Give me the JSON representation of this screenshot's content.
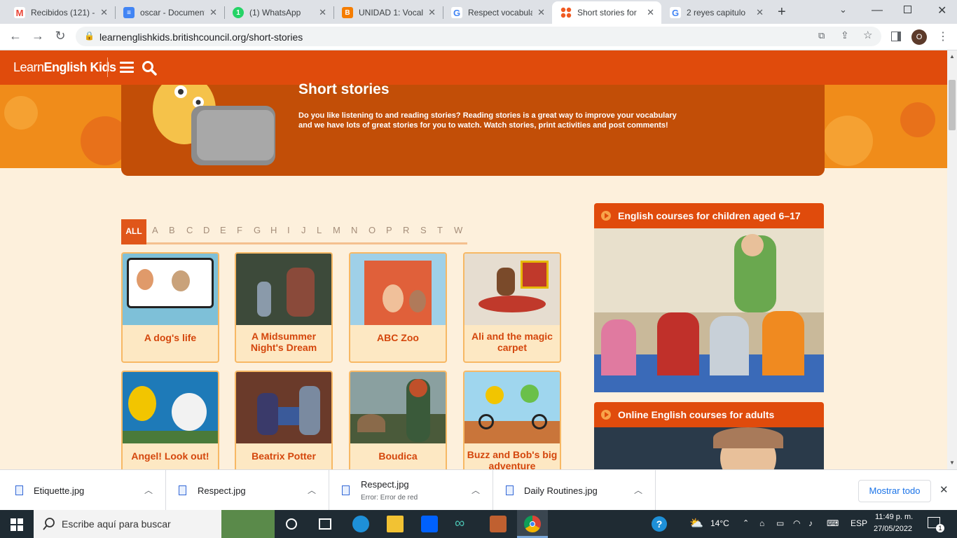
{
  "browser": {
    "tabs": [
      {
        "title": "Recibidos (121) -",
        "icon": "gmail-icon",
        "color": "#ea4335"
      },
      {
        "title": "oscar - Document",
        "icon": "docs-icon",
        "color": "#4285f4"
      },
      {
        "title": "(1) WhatsApp",
        "icon": "whatsapp-icon",
        "color": "#25d366"
      },
      {
        "title": "UNIDAD 1: Vocal",
        "icon": "blogger-icon",
        "color": "#f57d00"
      },
      {
        "title": "Respect vocabula",
        "icon": "google-icon",
        "color": "#4285f4"
      },
      {
        "title": "Short stories for",
        "icon": "britishcouncil-icon",
        "color": "#f05a22",
        "active": true
      },
      {
        "title": "2 reyes capitulo",
        "icon": "google-icon",
        "color": "#4285f4"
      }
    ],
    "url": "learnenglishkids.britishcouncil.org/short-stories",
    "profile_initial": "O"
  },
  "site": {
    "logo_light": "Learn",
    "logo_bold": "English Kids",
    "accent": "#e04b0c"
  },
  "banner": {
    "title": "Short stories",
    "text": "Do you like listening to and reading stories? Reading stories is a great way to improve your vocabulary and we have lots of great stories for you to watch. Watch stories, print activities and post comments!"
  },
  "alphabet": {
    "all": "ALL",
    "letters": [
      "A",
      "B",
      "C",
      "D",
      "E",
      "F",
      "G",
      "H",
      "I",
      "J",
      "L",
      "M",
      "N",
      "O",
      "P",
      "R",
      "S",
      "T",
      "W"
    ]
  },
  "stories": [
    {
      "title": "A dog's life"
    },
    {
      "title": "A Midsummer Night's Dream"
    },
    {
      "title": "ABC Zoo"
    },
    {
      "title": "Ali and the magic carpet"
    },
    {
      "title": "Angel! Look out!"
    },
    {
      "title": "Beatrix Potter"
    },
    {
      "title": "Boudica"
    },
    {
      "title": "Buzz and Bob's big adventure"
    }
  ],
  "sidebar": {
    "promo1": "English courses for children aged 6–17",
    "promo2": "Online English courses for adults"
  },
  "downloads": {
    "items": [
      {
        "name": "Etiquette.jpg",
        "status": ""
      },
      {
        "name": "Respect.jpg",
        "status": ""
      },
      {
        "name": "Respect.jpg",
        "status": "Error: Error de red"
      },
      {
        "name": "Daily Routines.jpg",
        "status": ""
      }
    ],
    "show_all": "Mostrar todo"
  },
  "taskbar": {
    "search_placeholder": "Escribe aquí para buscar",
    "temperature": "14°C",
    "language": "ESP",
    "time": "11:49 p. m.",
    "date": "27/05/2022",
    "notifications": "1"
  }
}
